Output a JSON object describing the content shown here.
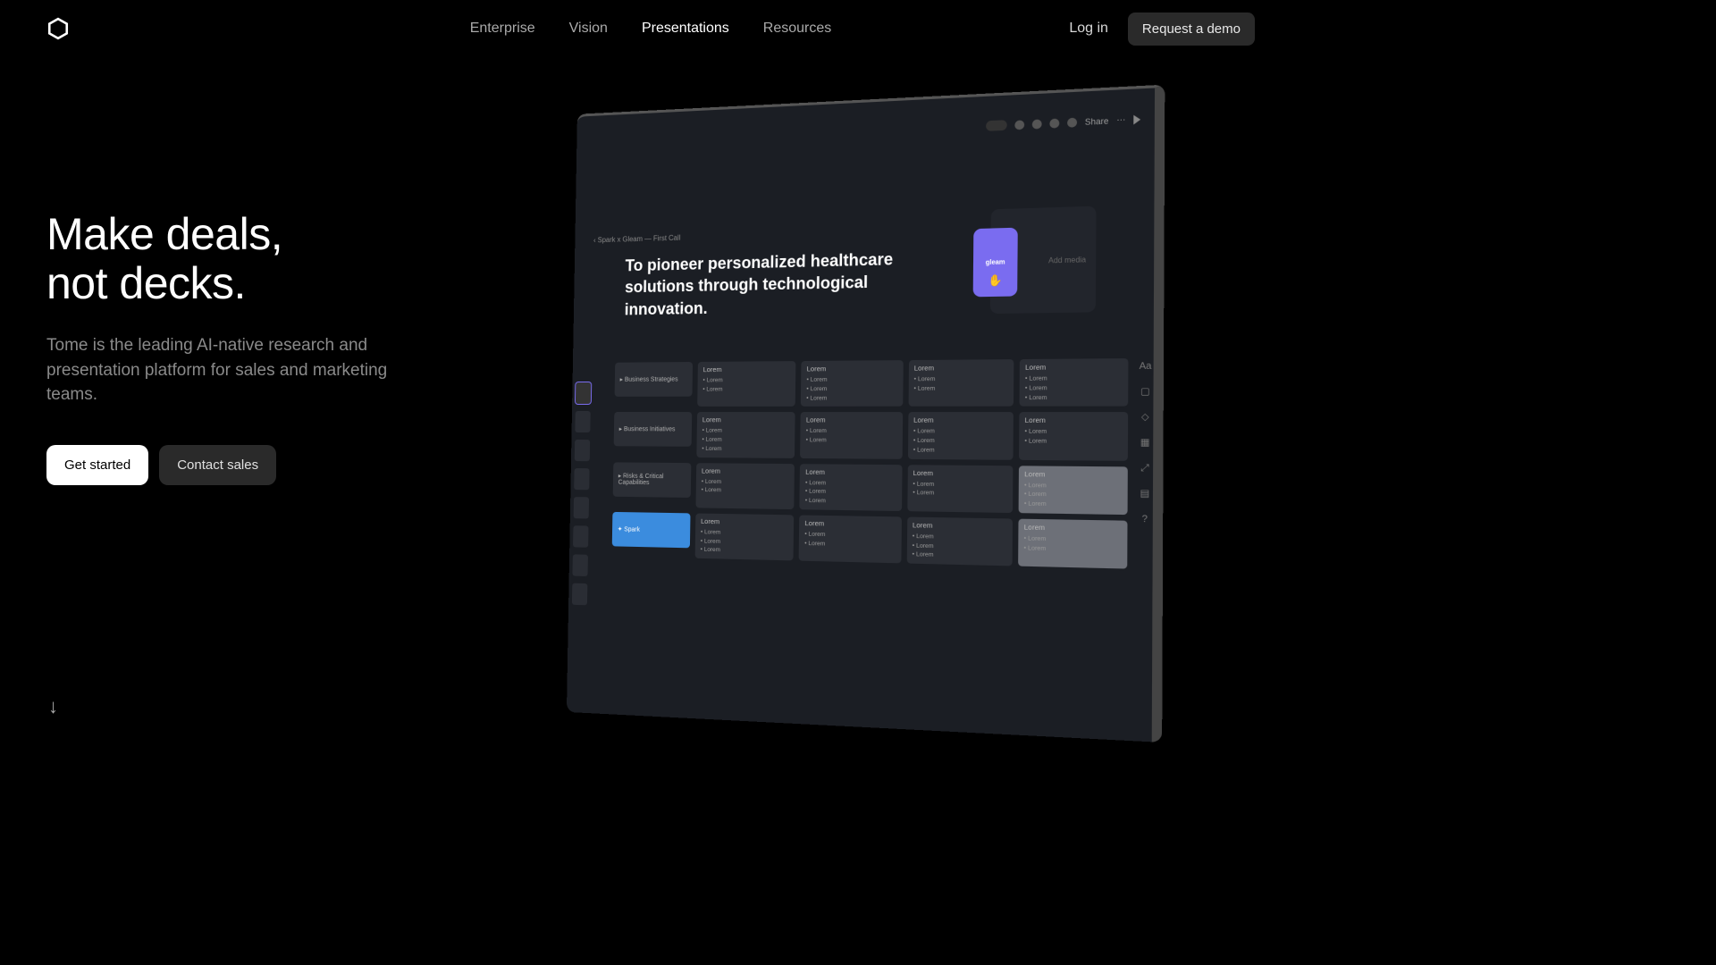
{
  "nav": {
    "links": [
      "Enterprise",
      "Vision",
      "Presentations",
      "Resources"
    ],
    "active": "Presentations",
    "login": "Log in",
    "demo": "Request a demo"
  },
  "hero": {
    "headline_line1": "Make deals,",
    "headline_line2": "not decks.",
    "subhead": "Tome is the leading AI-native research and presentation platform for sales and marketing teams.",
    "cta_primary": "Get started",
    "cta_secondary": "Contact sales"
  },
  "app": {
    "breadcrumb": "Spark x Gleam — First Call",
    "slide_title": "To pioneer personalized healthcare solutions through technological innovation.",
    "media": {
      "card_label": "gleam",
      "add_label": "Add media"
    },
    "share_label": "Share",
    "rows": [
      {
        "label": "Business Strategies",
        "spark": false
      },
      {
        "label": "Business Initiatives",
        "spark": false
      },
      {
        "label": "Risks & Critical Capabilities",
        "spark": false
      },
      {
        "label": "Spark",
        "spark": true
      }
    ],
    "cell_header": "Lorem",
    "cell_item": "Lorem"
  }
}
